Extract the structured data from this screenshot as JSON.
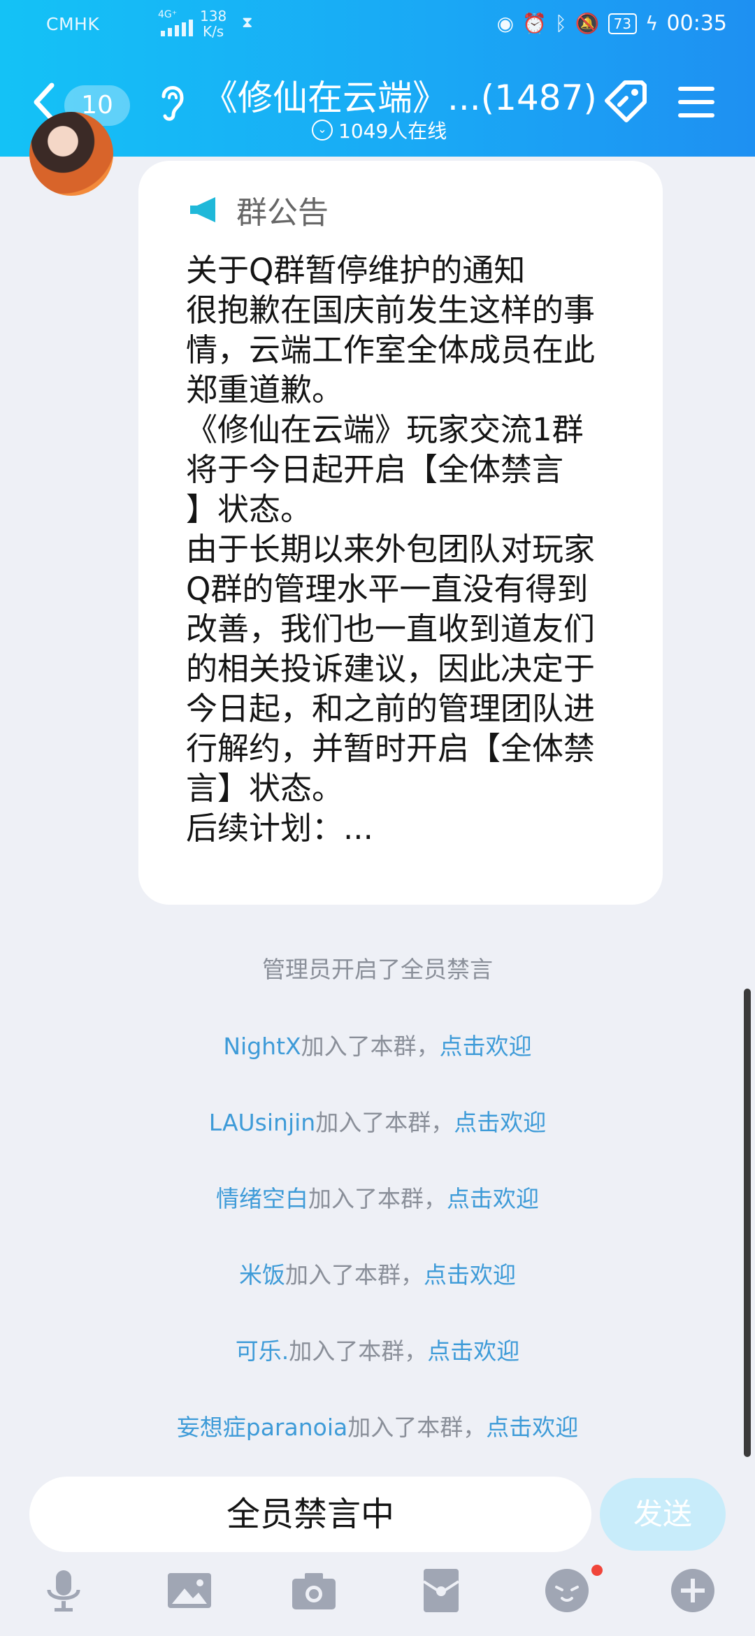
{
  "status_bar": {
    "carrier": "CMHK",
    "network": "4G⁺",
    "speed_top": "138",
    "speed_bottom": "K/s",
    "battery": "73",
    "time": "00:35"
  },
  "header": {
    "unread_count": "10",
    "title": "《修仙在云端》...(1487)",
    "online": "1049人在线"
  },
  "notice": {
    "heading": "群公告",
    "lines": [
      "关于Q群暂停维护的通知",
      "很抱歉在国庆前发生这样的事",
      "情，云端工作室全体成员在此",
      "郑重道歉。",
      "《修仙在云端》玩家交流1群",
      "将于今日起开启【全体禁言",
      "】状态。",
      "由于长期以来外包团队对玩家",
      "Q群的管理水平一直没有得到",
      "改善，我们也一直收到道友们",
      "的相关投诉建议，因此决定于",
      "今日起，和之前的管理团队进",
      "行解约，并暂时开启【全体禁",
      "言】状态。",
      "后续计划：..."
    ]
  },
  "system_message": "管理员开启了全员禁言",
  "joins": {
    "suffix": "加入了本群，",
    "welcome": "点击欢迎",
    "names": [
      "NightX",
      "LAUsinjin",
      "情绪空白",
      "米饭",
      "可乐.",
      "妄想症paranoia"
    ]
  },
  "input": {
    "text": "全员禁言中",
    "send_label": "发送"
  },
  "colors": {
    "header_start": "#14c2f6",
    "header_end": "#1e90f2",
    "link_blue": "#3e9bd8",
    "background": "#eef0f6"
  }
}
